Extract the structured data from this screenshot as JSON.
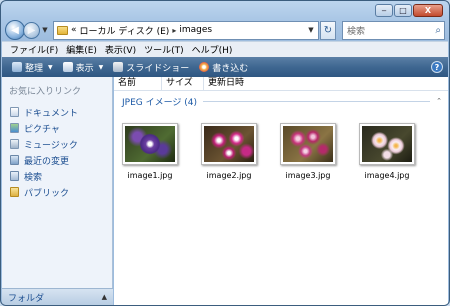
{
  "window": {
    "address": {
      "chevron": "«",
      "drive": "ローカル ディスク (E)",
      "separator": "▸",
      "folder": "images"
    },
    "search_placeholder": "検索",
    "controls": {
      "minimize": "‒",
      "maximize": "□",
      "close": "X"
    }
  },
  "menu": [
    "ファイル(F)",
    "編集(E)",
    "表示(V)",
    "ツール(T)",
    "ヘルプ(H)"
  ],
  "toolbar": {
    "organize": "整理",
    "view": "表示",
    "slideshow": "スライドショー",
    "burn": "書き込む",
    "help": "?"
  },
  "navpane": {
    "title": "お気に入りリンク",
    "items": [
      "ドキュメント",
      "ピクチャ",
      "ミュージック",
      "最近の変更",
      "検索",
      "パブリック"
    ],
    "footer": "フォルダ"
  },
  "columns": [
    "名前",
    "サイズ",
    "更新日時"
  ],
  "group_label": "JPEG イメージ (4)",
  "files": [
    {
      "name": "image1.jpg"
    },
    {
      "name": "image2.jpg"
    },
    {
      "name": "image3.jpg"
    },
    {
      "name": "image4.jpg"
    }
  ]
}
